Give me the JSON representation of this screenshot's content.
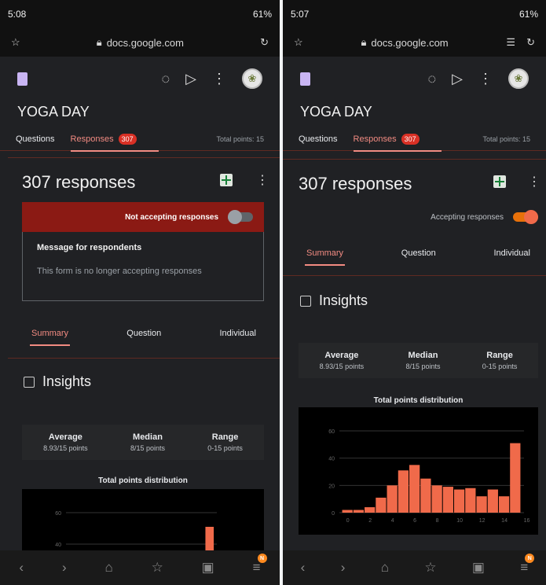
{
  "left": {
    "status": {
      "time": "5:08",
      "battery": "61%"
    },
    "url": "docs.google.com",
    "form_title": "YOGA DAY",
    "tabs": {
      "questions": "Questions",
      "responses": "Responses",
      "badge": "307",
      "total_points": "Total points: 15"
    },
    "responses_header": "307 responses",
    "accepting_banner": {
      "label": "Not accepting responses",
      "on": false
    },
    "message": {
      "heading": "Message for respondents",
      "text": "This form is no longer accepting responses"
    },
    "subtabs": [
      "Summary",
      "Question",
      "Individual"
    ],
    "insights": "Insights",
    "stats": [
      {
        "label": "Average",
        "value": "8.93/15 points"
      },
      {
        "label": "Median",
        "value": "8/15 points"
      },
      {
        "label": "Range",
        "value": "0-15 points"
      }
    ],
    "chart_title": "Total points distribution"
  },
  "right": {
    "status": {
      "time": "5:07",
      "battery": "61%"
    },
    "url": "docs.google.com",
    "form_title": "YOGA DAY",
    "tabs": {
      "questions": "Questions",
      "responses": "Responses",
      "badge": "307",
      "total_points": "Total points: 15"
    },
    "responses_header": "307 responses",
    "accepting_toggle": {
      "label": "Accepting responses",
      "on": true
    },
    "subtabs": [
      "Summary",
      "Question",
      "Individual"
    ],
    "insights": "Insights",
    "stats": [
      {
        "label": "Average",
        "value": "8.93/15 points"
      },
      {
        "label": "Median",
        "value": "8/15 points"
      },
      {
        "label": "Range",
        "value": "0-15 points"
      }
    ],
    "chart_title": "Total points distribution"
  },
  "nav_badge": "N",
  "colors": {
    "accent": "#f28b82",
    "bar": "#f06a4a",
    "banner_red": "#8b1a14",
    "background": "#202124"
  },
  "chart_data": [
    {
      "type": "bar",
      "title": "Total points distribution",
      "xlabel": "",
      "ylabel": "",
      "x": [
        0,
        1,
        2,
        3,
        4,
        5,
        6,
        7,
        8,
        9,
        10,
        11,
        12,
        13,
        14,
        15
      ],
      "values": [
        2,
        2,
        4,
        11,
        20,
        31,
        35,
        25,
        20,
        19,
        17,
        18,
        12,
        17,
        12,
        51
      ],
      "xticks": [
        "0",
        "2",
        "4",
        "6",
        "8",
        "10",
        "12",
        "14",
        "16"
      ],
      "yticks": [
        "0",
        "20",
        "40",
        "60"
      ],
      "ylim": [
        0,
        60
      ]
    }
  ]
}
